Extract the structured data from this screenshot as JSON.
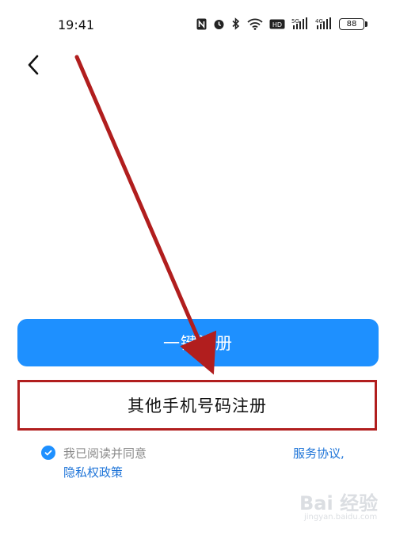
{
  "status_bar": {
    "time": "19:41",
    "battery": "88",
    "signal_labels": [
      "5G",
      "4G"
    ]
  },
  "back": {
    "icon": "chevron-left-icon"
  },
  "buttons": {
    "one_click_register": "一键注册",
    "other_number_register": "其他手机号码注册"
  },
  "agreement": {
    "prefix": "我已阅读并同意",
    "service_link": "服务协议,",
    "privacy_link": "隐私权政策",
    "checked": true
  },
  "watermark": {
    "brand": "Bai 经验",
    "url": "jingyan.baidu.com"
  },
  "colors": {
    "primary": "#1e90ff",
    "link": "#1e74d8",
    "annotation": "#b11e1e"
  }
}
